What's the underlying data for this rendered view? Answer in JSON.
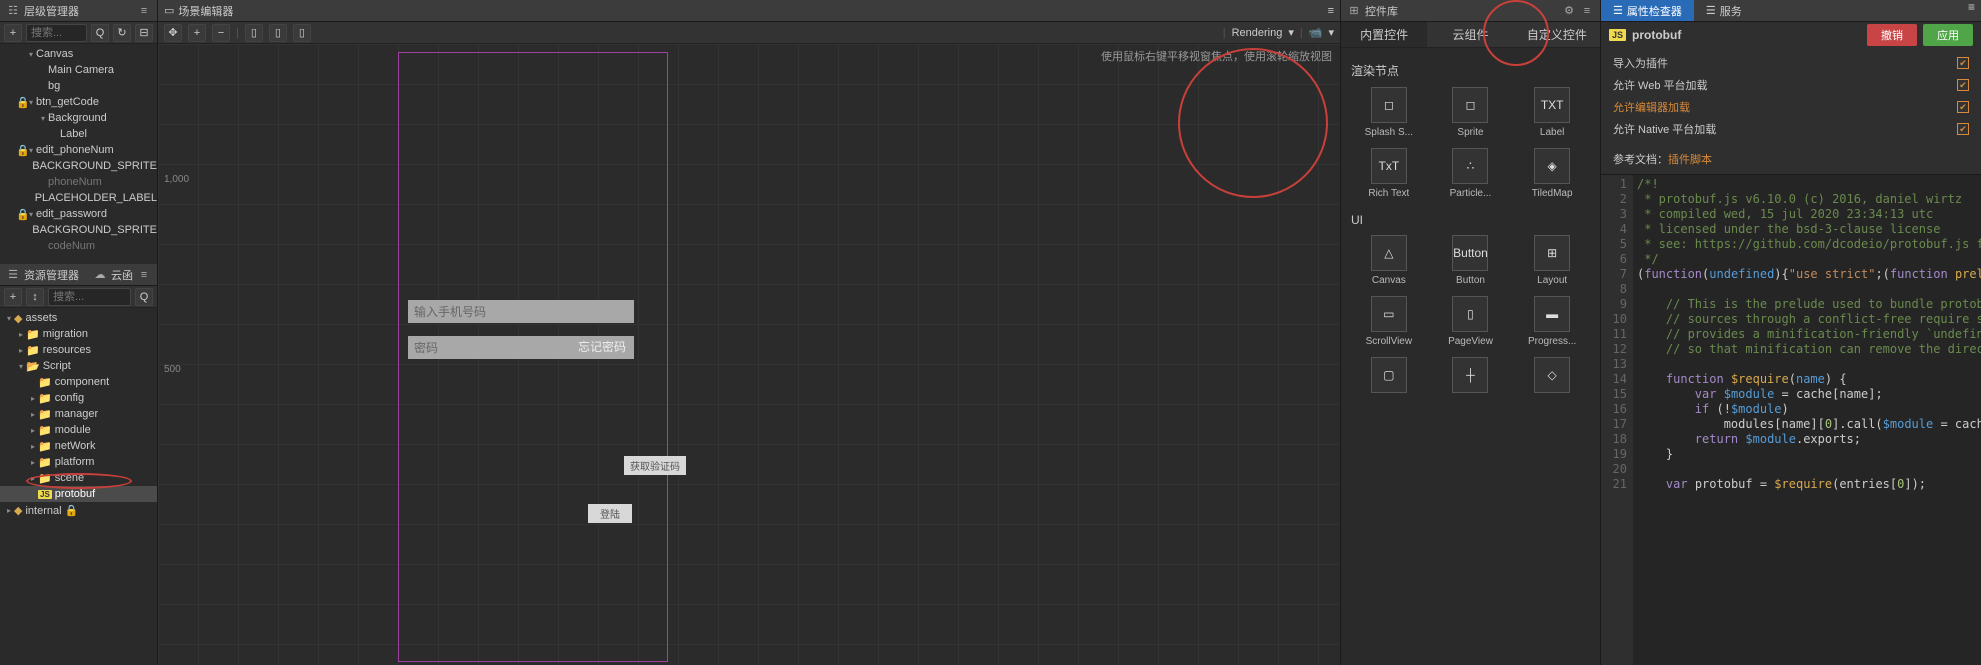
{
  "hierarchy": {
    "title": "层级管理器",
    "search_placeholder": "捜索...",
    "items": [
      {
        "indent": 1,
        "arrow": "▾",
        "label": "Canvas"
      },
      {
        "indent": 2,
        "label": "Main Camera"
      },
      {
        "indent": 2,
        "label": "bg"
      },
      {
        "indent": 1,
        "arrow": "▾",
        "locked": true,
        "label": "btn_getCode"
      },
      {
        "indent": 2,
        "arrow": "▾",
        "label": "Background"
      },
      {
        "indent": 3,
        "label": "Label"
      },
      {
        "indent": 1,
        "arrow": "▾",
        "locked": true,
        "label": "edit_phoneNum"
      },
      {
        "indent": 2,
        "label": "BACKGROUND_SPRITE"
      },
      {
        "indent": 2,
        "dim": true,
        "label": "phoneNum"
      },
      {
        "indent": 2,
        "label": "PLACEHOLDER_LABEL"
      },
      {
        "indent": 1,
        "arrow": "▾",
        "locked": true,
        "label": "edit_password"
      },
      {
        "indent": 2,
        "label": "BACKGROUND_SPRITE"
      },
      {
        "indent": 2,
        "dim": true,
        "label": "codeNum"
      }
    ]
  },
  "assets": {
    "title": "资源管理器",
    "cloud_title": "云函",
    "search_placeholder": "捜索...",
    "items": [
      {
        "indent": 0,
        "arrow": "▾",
        "kind": "db",
        "label": "assets"
      },
      {
        "indent": 1,
        "arrow": "▸",
        "kind": "folder",
        "label": "migration"
      },
      {
        "indent": 1,
        "arrow": "▸",
        "kind": "folder",
        "label": "resources"
      },
      {
        "indent": 1,
        "arrow": "▾",
        "kind": "folder-open",
        "label": "Script"
      },
      {
        "indent": 2,
        "kind": "folder",
        "label": "component"
      },
      {
        "indent": 2,
        "arrow": "▸",
        "kind": "folder",
        "label": "config"
      },
      {
        "indent": 2,
        "arrow": "▸",
        "kind": "folder",
        "label": "manager"
      },
      {
        "indent": 2,
        "arrow": "▸",
        "kind": "folder",
        "label": "module"
      },
      {
        "indent": 2,
        "arrow": "▸",
        "kind": "folder",
        "label": "netWork"
      },
      {
        "indent": 2,
        "arrow": "▸",
        "kind": "folder",
        "label": "platform"
      },
      {
        "indent": 2,
        "arrow": "▸",
        "kind": "folder",
        "label": "scene"
      },
      {
        "indent": 2,
        "kind": "js",
        "label": "protobuf",
        "selected": true
      },
      {
        "indent": 0,
        "arrow": "▸",
        "kind": "db",
        "label": "internal 🔒"
      }
    ]
  },
  "scene": {
    "title": "场景编辑器",
    "rendering_label": "Rendering",
    "hint": "使用鼠标右键平移视窗焦点，使用滚轮缩放视图",
    "ruler_1000": "1,000",
    "ruler_500": "500",
    "input_phone": "输入手机号码",
    "input_pwd": "密码",
    "link_forget": "忘记密码",
    "btn_getcode": "获取验证码",
    "btn_login": "登陆"
  },
  "components": {
    "title": "控件库",
    "tabs": [
      "内置控件",
      "云组件",
      "自定义控件"
    ],
    "section_render": "渲染节点",
    "section_ui": "UI",
    "items_render": [
      {
        "icon": "◻",
        "label": "Splash S..."
      },
      {
        "icon": "◻",
        "label": "Sprite"
      },
      {
        "icon": "TXT",
        "label": "Label"
      },
      {
        "icon": "TxT",
        "label": "Rich Text"
      },
      {
        "icon": "∴",
        "label": "Particle..."
      },
      {
        "icon": "◈",
        "label": "TiledMap"
      }
    ],
    "items_ui": [
      {
        "icon": "△",
        "label": "Canvas"
      },
      {
        "icon": "Button",
        "label": "Button"
      },
      {
        "icon": "⊞",
        "label": "Layout"
      },
      {
        "icon": "▭",
        "label": "ScrollView"
      },
      {
        "icon": "▯",
        "label": "PageView"
      },
      {
        "icon": "▬",
        "label": "Progress..."
      },
      {
        "icon": "▢",
        "label": ""
      },
      {
        "icon": "┼",
        "label": ""
      },
      {
        "icon": "◇",
        "label": ""
      }
    ]
  },
  "inspector": {
    "tab_props": "属性检查器",
    "tab_services": "服务",
    "file_title": "protobuf",
    "btn_undo": "撤销",
    "btn_apply": "应用",
    "rows": [
      {
        "label": "导入为插件",
        "checked": true
      },
      {
        "label": "允许 Web 平台加载",
        "checked": true
      },
      {
        "label": "允许编辑器加载",
        "checked": true,
        "highlight": true
      },
      {
        "label": "允许 Native 平台加载",
        "checked": true
      }
    ],
    "doc_label": "参考文档：",
    "doc_link": "插件脚本"
  },
  "code_lines": [
    [
      [
        "comment",
        "/*!"
      ]
    ],
    [
      [
        "comment",
        " * protobuf.js v6.10.0 (c) 2016, daniel wirtz"
      ]
    ],
    [
      [
        "comment",
        " * compiled wed, 15 jul 2020 23:34:13 utc"
      ]
    ],
    [
      [
        "comment",
        " * licensed under the bsd-3-clause license"
      ]
    ],
    [
      [
        "comment",
        " * see: https://github.com/dcodeio/protobuf.js for"
      ]
    ],
    [
      [
        "comment",
        " */"
      ]
    ],
    [
      [
        "text",
        "("
      ],
      [
        "kw",
        "function"
      ],
      [
        "text",
        "("
      ],
      [
        "var",
        "undefined"
      ],
      [
        "text",
        "){"
      ],
      [
        "str",
        "\"use strict\""
      ],
      [
        "text",
        ";("
      ],
      [
        "kw",
        "function"
      ],
      [
        "text",
        " "
      ],
      [
        "fn",
        "prelu"
      ]
    ],
    [],
    [
      [
        "comment",
        "    // This is the prelude used to bundle protobu"
      ]
    ],
    [
      [
        "comment",
        "    // sources through a conflict-free require sh"
      ]
    ],
    [
      [
        "comment",
        "    // provides a minification-friendly `undefine"
      ]
    ],
    [
      [
        "comment",
        "    // so that minification can remove the direct"
      ]
    ],
    [],
    [
      [
        "text",
        "    "
      ],
      [
        "kw",
        "function"
      ],
      [
        "text",
        " "
      ],
      [
        "fn",
        "$require"
      ],
      [
        "text",
        "("
      ],
      [
        "var",
        "name"
      ],
      [
        "text",
        ") {"
      ]
    ],
    [
      [
        "text",
        "        "
      ],
      [
        "kw",
        "var"
      ],
      [
        "text",
        " "
      ],
      [
        "var",
        "$module"
      ],
      [
        "text",
        " = cache[name];"
      ]
    ],
    [
      [
        "text",
        "        "
      ],
      [
        "kw",
        "if"
      ],
      [
        "text",
        " (!"
      ],
      [
        "var",
        "$module"
      ],
      [
        "text",
        ")"
      ]
    ],
    [
      [
        "text",
        "            modules[name]["
      ],
      [
        "num",
        "0"
      ],
      [
        "text",
        "].call("
      ],
      [
        "var",
        "$module"
      ],
      [
        "text",
        " = cache"
      ]
    ],
    [
      [
        "text",
        "        "
      ],
      [
        "kw",
        "return"
      ],
      [
        "text",
        " "
      ],
      [
        "var",
        "$module"
      ],
      [
        "text",
        ".exports;"
      ]
    ],
    [
      [
        "text",
        "    }"
      ]
    ],
    [],
    [
      [
        "text",
        "    "
      ],
      [
        "kw",
        "var"
      ],
      [
        "text",
        " protobuf = "
      ],
      [
        "fn",
        "$require"
      ],
      [
        "text",
        "(entries["
      ],
      [
        "num",
        "0"
      ],
      [
        "text",
        "]);"
      ]
    ]
  ]
}
